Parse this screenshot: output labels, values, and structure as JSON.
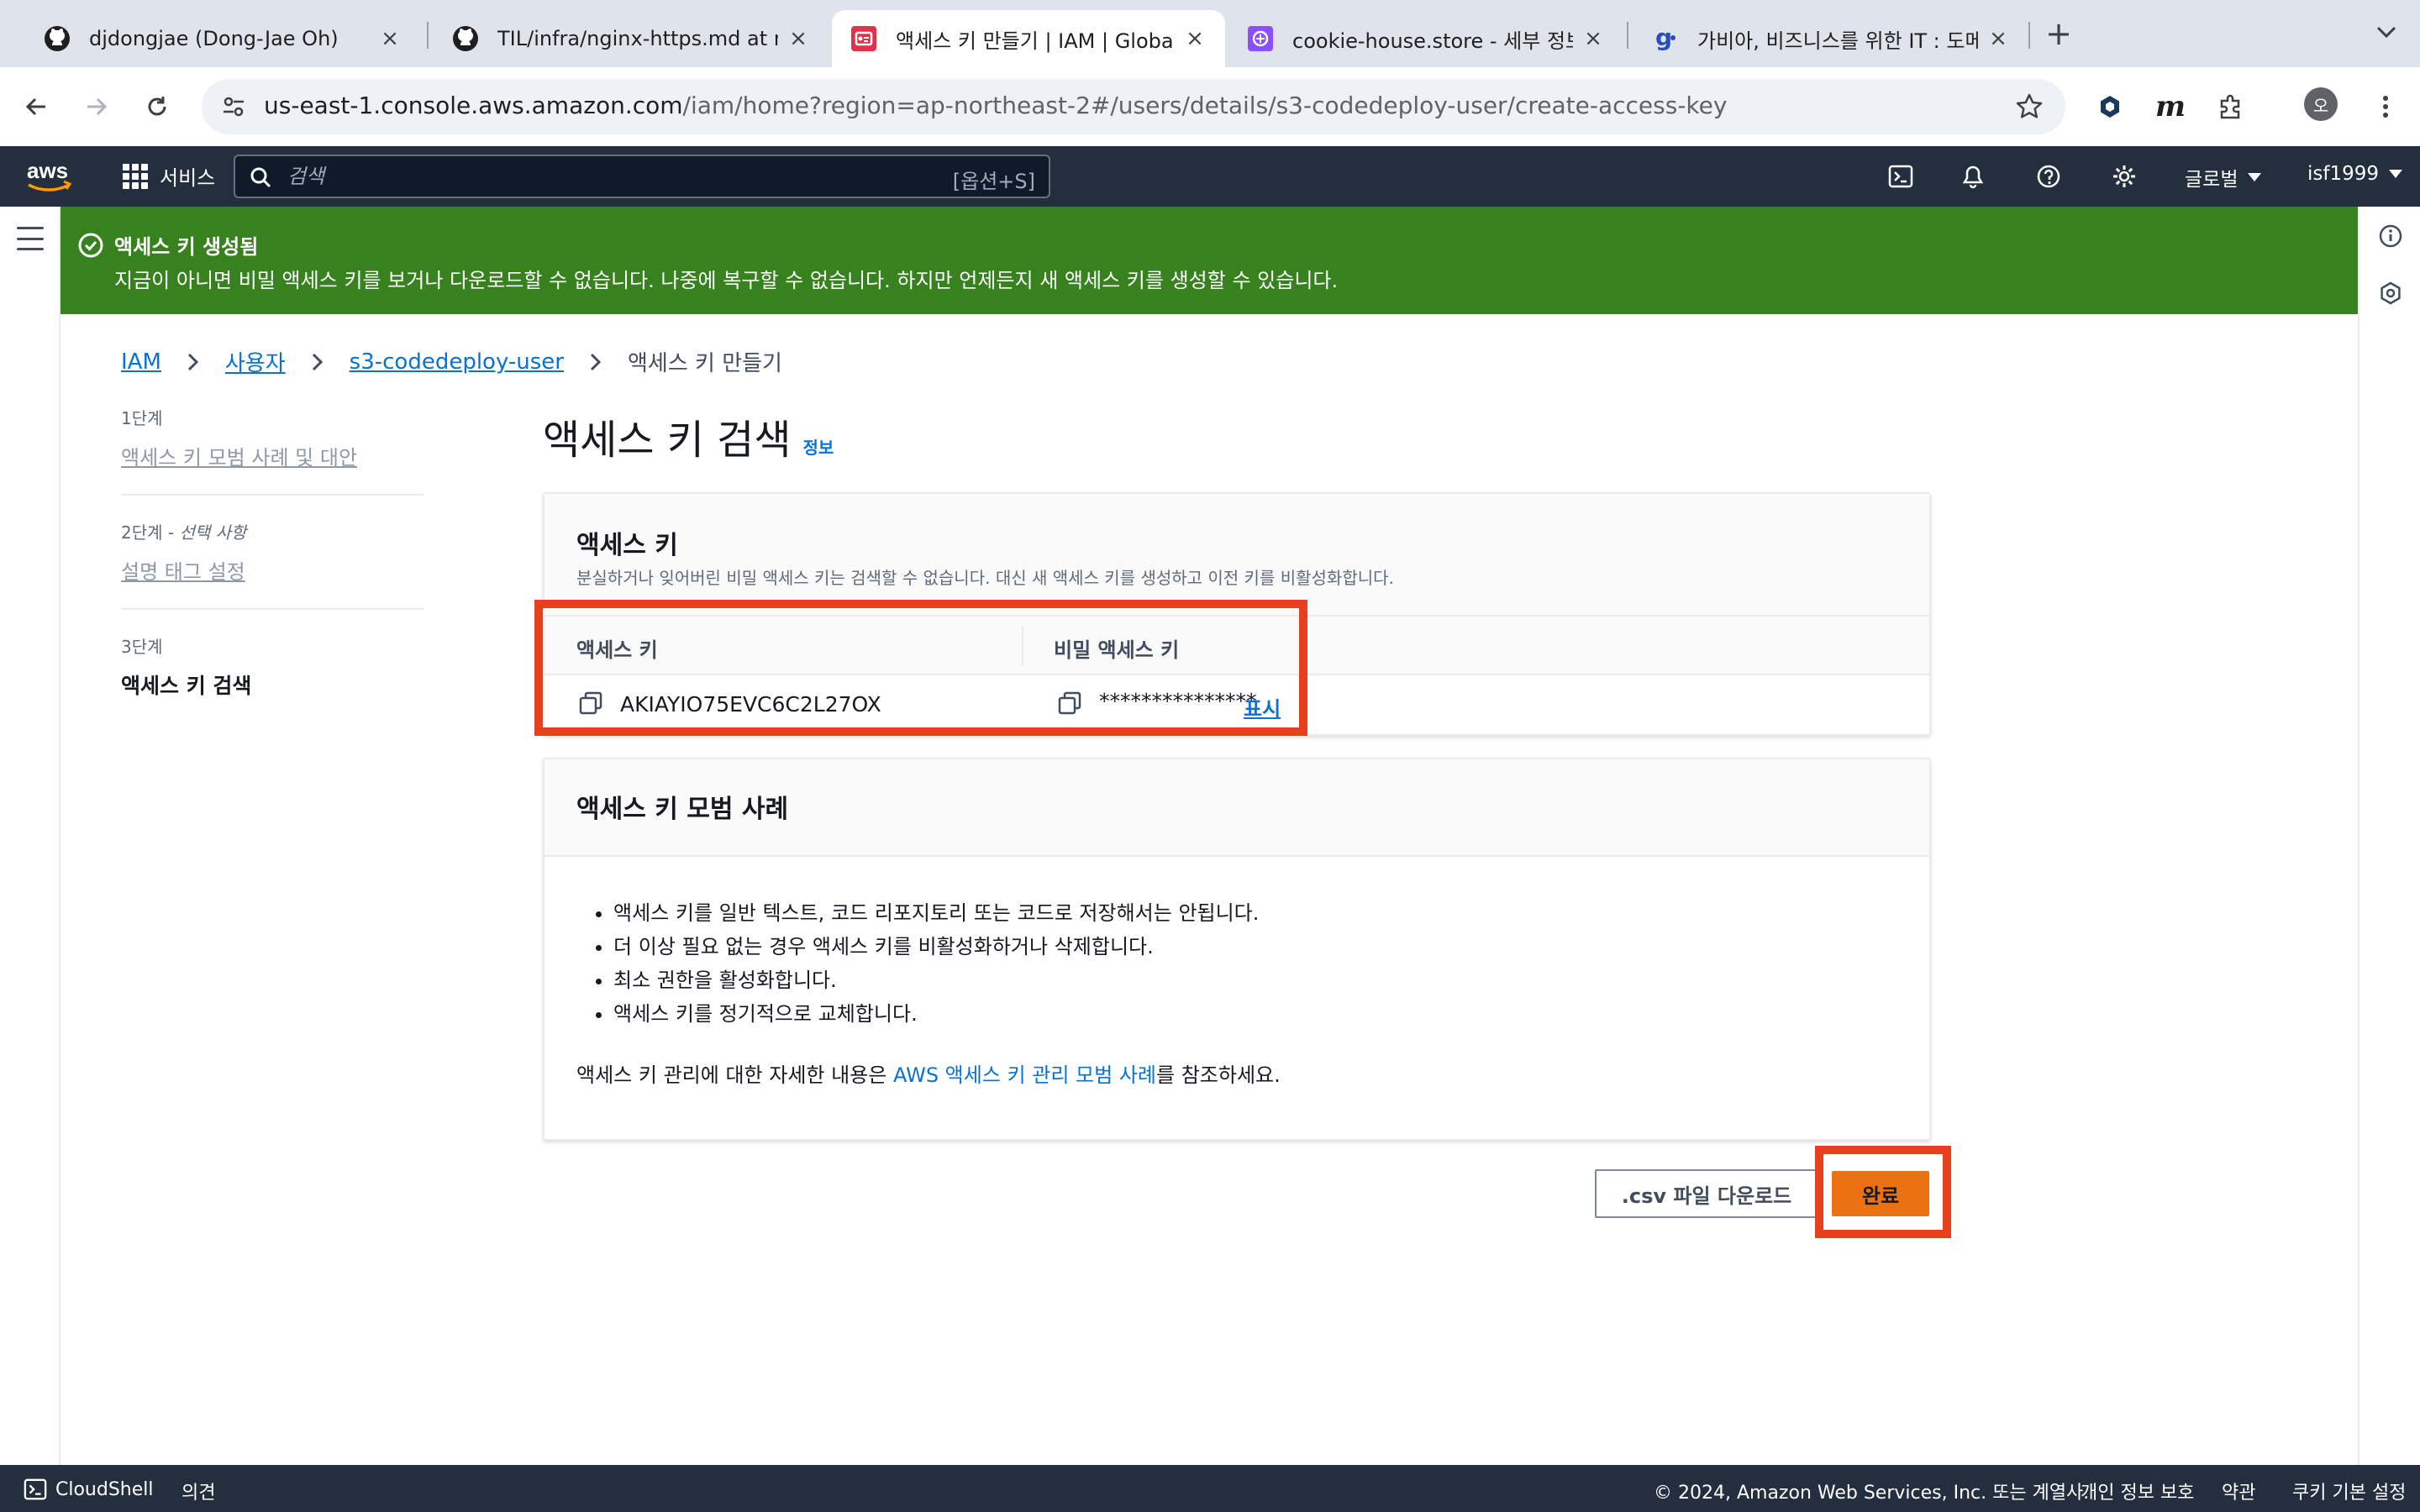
{
  "browser": {
    "tabs": [
      {
        "title": "djdongjae (Dong-Jae Oh)",
        "icon": "github-icon"
      },
      {
        "title": "TIL/infra/nginx-https.md at m",
        "icon": "github-icon"
      },
      {
        "title": "액세스 키 만들기 | IAM | Global",
        "icon": "aws-iam-icon"
      },
      {
        "title": "cookie-house.store - 세부 정보",
        "icon": "aws-route53-icon"
      },
      {
        "title": "가비아, 비즈니스를 위한 IT : 도메인",
        "icon": "gabia-icon"
      }
    ],
    "active_tab": 2,
    "url_host": "us-east-1.console.aws.amazon.com",
    "url_path": "/iam/home?region=ap-northeast-2#/users/details/s3-codedeploy-user/create-access-key",
    "profile_initial": "오"
  },
  "aws_header": {
    "services_label": "서비스",
    "search_placeholder": "검색",
    "search_shortcut": "[옵션+S]",
    "region_label": "글로벌",
    "account_label": "isf1999"
  },
  "flash": {
    "title": "액세스 키 생성됨",
    "message": "지금이 아니면 비밀 액세스 키를 보거나 다운로드할 수 없습니다. 나중에 복구할 수 없습니다. 하지만 언제든지 새 액세스 키를 생성할 수 있습니다."
  },
  "breadcrumb": {
    "items": [
      "IAM",
      "사용자",
      "s3-codedeploy-user"
    ],
    "current": "액세스 키 만들기"
  },
  "steps": [
    {
      "number": "1단계",
      "optional": "",
      "label": "액세스 키 모범 사례 및 대안"
    },
    {
      "number": "2단계",
      "optional": "선택 사항",
      "label": "설명 태그 설정"
    },
    {
      "number": "3단계",
      "optional": "",
      "label": "액세스 키 검색"
    }
  ],
  "page": {
    "title": "액세스 키 검색",
    "info_link": "정보"
  },
  "access_key_card": {
    "title": "액세스 키",
    "description": "분실하거나 잊어버린 비밀 액세스 키는 검색할 수 없습니다. 대신 새 액세스 키를 생성하고 이전 키를 비활성화합니다.",
    "col_access_key": "액세스 키",
    "col_secret_key": "비밀 액세스 키",
    "access_key_value": "AKIAYIO75EVC6C2L27OX",
    "secret_key_masked": "***************",
    "show_label": "표시"
  },
  "best_practices_card": {
    "title": "액세스 키 모범 사례",
    "bullets": [
      "액세스 키를 일반 텍스트, 코드 리포지토리 또는 코드로 저장해서는 안됩니다.",
      "더 이상 필요 없는 경우 액세스 키를 비활성화하거나 삭제합니다.",
      "최소 권한을 활성화합니다.",
      "액세스 키를 정기적으로 교체합니다."
    ],
    "ref_prefix": "액세스 키 관리에 대한 자세한 내용은 ",
    "ref_link": "AWS 액세스 키 관리 모범 사례",
    "ref_suffix": "를 참조하세요."
  },
  "actions": {
    "download_csv": ".csv 파일 다운로드",
    "done": "완료"
  },
  "footer": {
    "cloudshell": "CloudShell",
    "feedback": "의견",
    "copyright": "© 2024, Amazon Web Services, Inc. 또는 계열사.",
    "privacy": "개인 정보 보호",
    "terms": "약관",
    "cookies": "쿠키 기본 설정"
  },
  "colors": {
    "aws_nav": "#232f3e",
    "flash_success": "#37811f",
    "link": "#0972d3",
    "primary_button": "#ec7211",
    "annotation_box": "#e8401f"
  }
}
